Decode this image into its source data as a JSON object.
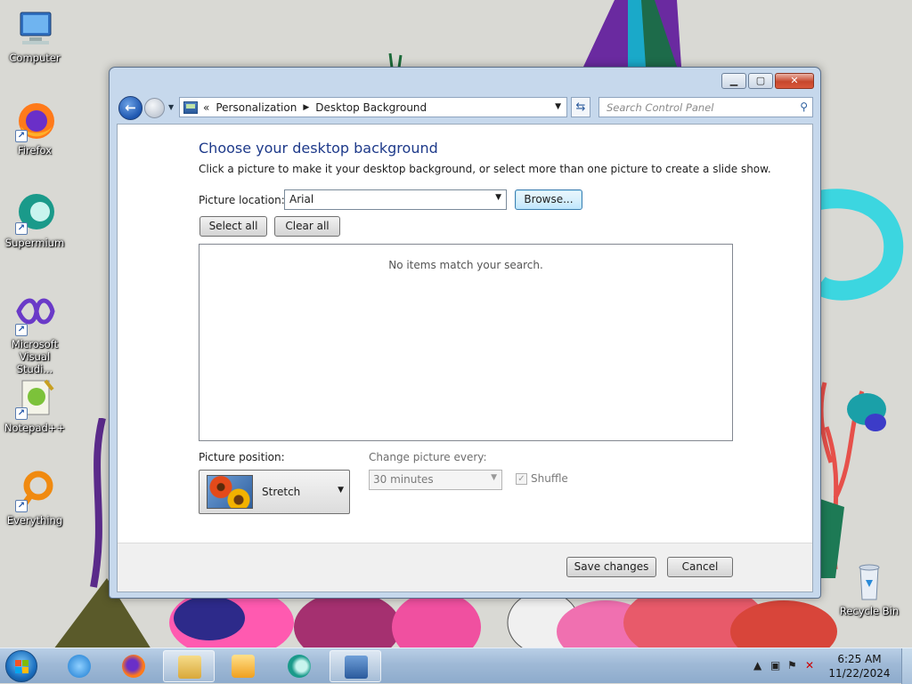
{
  "desktop": {
    "icons": [
      {
        "label": "Computer",
        "icon": "computer-icon"
      },
      {
        "label": "Firefox",
        "icon": "firefox-icon"
      },
      {
        "label": "Supermium",
        "icon": "supermium-icon"
      },
      {
        "label": "Microsoft Visual Studi...",
        "icon": "visual-studio-icon"
      },
      {
        "label": "Notepad++",
        "icon": "notepadpp-icon"
      },
      {
        "label": "Everything",
        "icon": "everything-icon"
      }
    ],
    "recycle_bin_label": "Recycle Bin"
  },
  "window": {
    "breadcrumb": {
      "chevron": "«",
      "items": [
        "Personalization",
        "Desktop Background"
      ],
      "separator": "▶"
    },
    "search_placeholder": "Search Control Panel",
    "title": "Choose your desktop background",
    "subtitle": "Click a picture to make it your desktop background, or select more than one picture to create a slide show.",
    "picture_location_label": "Picture location:",
    "picture_location_value": "Arial",
    "browse_label": "Browse...",
    "select_all_label": "Select all",
    "clear_all_label": "Clear all",
    "empty_message": "No items match your search.",
    "picture_position_label": "Picture position:",
    "picture_position_value": "Stretch",
    "change_picture_label": "Change picture every:",
    "change_picture_value": "30 minutes",
    "shuffle_label": "Shuffle",
    "shuffle_checked": true,
    "save_label": "Save changes",
    "cancel_label": "Cancel",
    "caption_buttons": {
      "minimize": "▁",
      "maximize": "▢",
      "close": "✕"
    }
  },
  "taskbar": {
    "time": "6:25 AM",
    "date": "11/22/2024",
    "apps": [
      "internet-explorer-icon",
      "firefox-icon",
      "file-explorer-icon",
      "media-player-icon",
      "supermium-icon",
      "control-panel-icon"
    ]
  }
}
